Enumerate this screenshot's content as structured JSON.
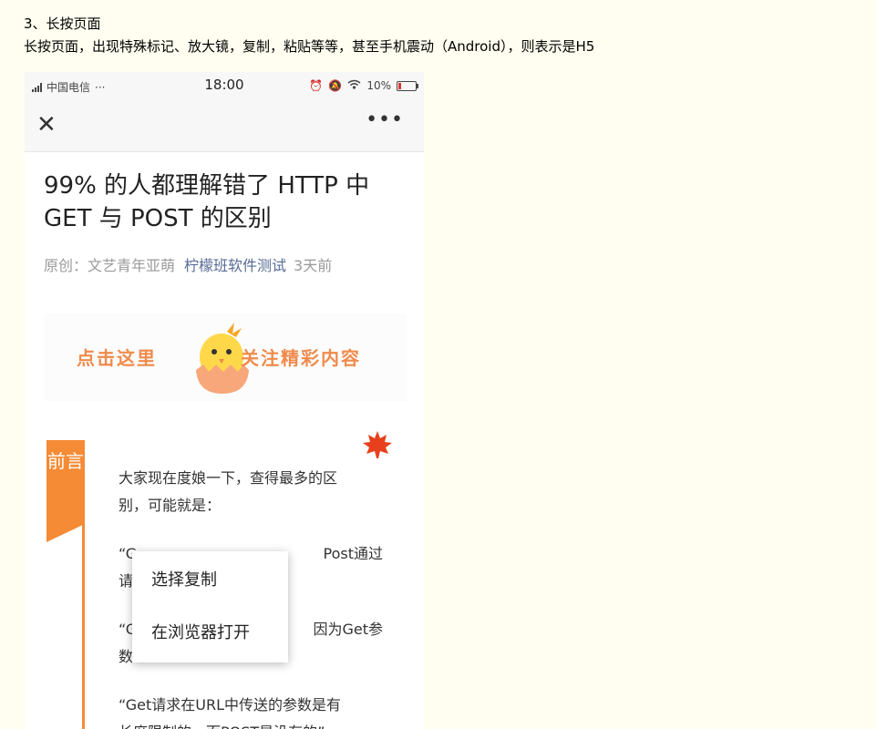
{
  "doc": {
    "heading": "3、长按页面",
    "description": "长按页面，出现特殊标记、放大镜，复制，粘贴等等，甚至手机震动（Android），则表示是H5"
  },
  "status_bar": {
    "carrier": "中国电信",
    "dots": "···",
    "time": "18:00",
    "battery": "10%"
  },
  "nav": {
    "close_icon": "close-icon",
    "more_icon": "more-icon"
  },
  "article": {
    "title": "99% 的人都理解错了 HTTP 中 GET 与 POST 的区别",
    "author_label": "原创：文艺青年亚萌",
    "account": "柠檬班软件测试",
    "time_ago": "3天前",
    "banner_left": "点击这里",
    "banner_right": "关注精彩内容",
    "section_tag": "前言",
    "para1_line1": "大家现在度娘一下，查得最多的区",
    "para1_line2": "别，可能就是：",
    "para2_line1_start": "“G",
    "para2_line1_end": "Post通过",
    "para2_line2_start": "请",
    "para3_line1_start": "“G",
    "para3_line1_end": "因为Get参",
    "para3_line2_start": "数",
    "para4_line1": "“Get请求在URL中传送的参数是有",
    "para4_line2": "长度限制的，而POST是没有的”"
  },
  "context_menu": {
    "items": [
      "选择复制",
      "在浏览器打开"
    ]
  },
  "colors": {
    "accent": "#f58b35",
    "link": "#576b95",
    "page_bg": "#fffef0"
  }
}
